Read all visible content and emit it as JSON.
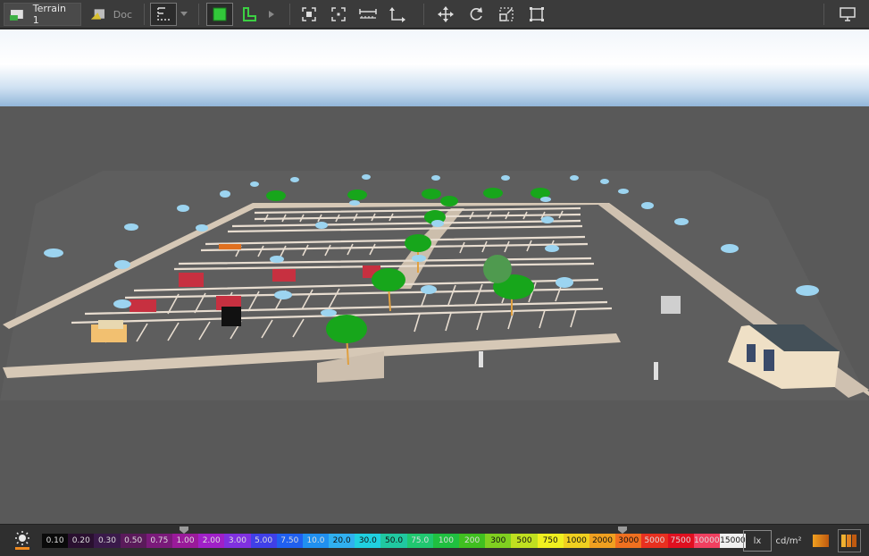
{
  "toolbar": {
    "tabs": [
      {
        "label": "Terrain 1",
        "active": true
      },
      {
        "label": "Doc",
        "active": false
      }
    ],
    "icons": [
      "selection-icon",
      "dropdown-arrow-icon",
      "green-cube-icon",
      "l-shape-icon",
      "play-arrow-icon",
      "fit-view-icon",
      "focus-icon",
      "measure-distance-icon",
      "dimension-icon",
      "move-icon",
      "rotate-icon",
      "scale-icon",
      "rectangle-icon",
      "monitor-icon"
    ]
  },
  "legend": {
    "values": [
      "0.10",
      "0.20",
      "0.30",
      "0.50",
      "0.75",
      "1.00",
      "2.00",
      "3.00",
      "5.00",
      "7.50",
      "10.0",
      "20.0",
      "30.0",
      "50.0",
      "75.0",
      "100",
      "200",
      "300",
      "500",
      "750",
      "1000",
      "2000",
      "3000",
      "5000",
      "7500",
      "10000",
      "15000"
    ],
    "colors": [
      "#0a0a0a",
      "#2a1030",
      "#3a1a4a",
      "#5a1a5a",
      "#7a1a7a",
      "#9a1a9a",
      "#a020c8",
      "#8030e0",
      "#4040e8",
      "#2060f0",
      "#2090f0",
      "#30b0f0",
      "#20d0e0",
      "#20c8a0",
      "#20c870",
      "#20c040",
      "#40c020",
      "#80d020",
      "#c0e020",
      "#f0f020",
      "#f0d020",
      "#f0a020",
      "#f07020",
      "#e83020",
      "#e01020",
      "#f04060",
      "#f0f0f0"
    ],
    "unit_lx": "lx",
    "unit_cdm2": "cd/m²"
  },
  "status": {
    "settings_icon": "sun-settings-icon"
  }
}
